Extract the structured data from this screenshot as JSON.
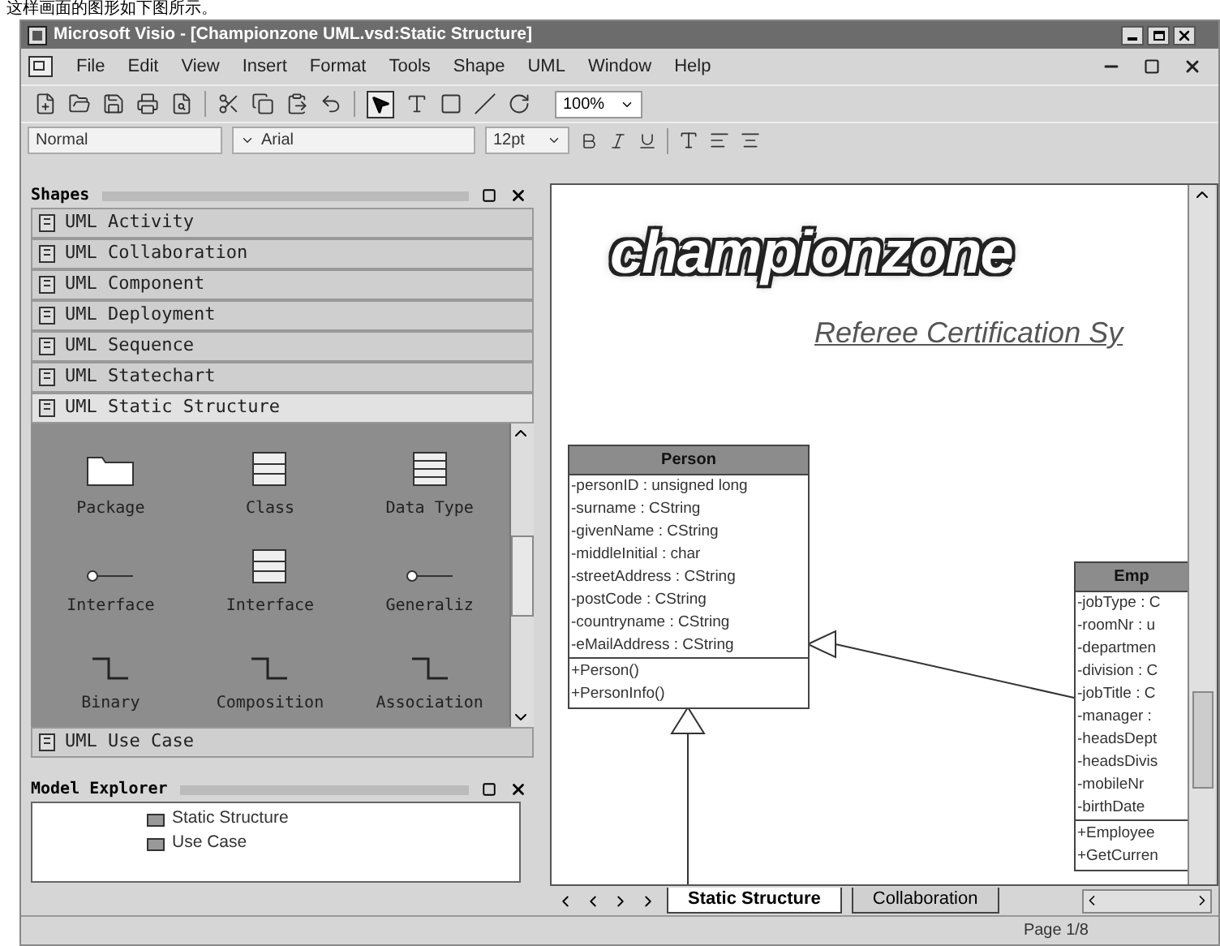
{
  "caption": "这样画面的图形如下图所示。",
  "window": {
    "title": "Microsoft Visio - [Championzone UML.vsd:Static Structure]"
  },
  "menu": [
    "File",
    "Edit",
    "View",
    "Insert",
    "Format",
    "Tools",
    "Shape",
    "UML",
    "Window",
    "Help"
  ],
  "toolbar": {
    "zoom": "100%"
  },
  "format_toolbar": {
    "style": "Normal",
    "font": "Arial",
    "size": "12pt"
  },
  "shapes_panel": {
    "title": "Shapes",
    "stencils": [
      {
        "label": "UML Activity",
        "expanded": false
      },
      {
        "label": "UML Collaboration",
        "expanded": false
      },
      {
        "label": "UML Component",
        "expanded": false
      },
      {
        "label": "UML Deployment",
        "expanded": false
      },
      {
        "label": "UML Sequence",
        "expanded": false
      },
      {
        "label": "UML Statechart",
        "expanded": false
      },
      {
        "label": "UML Static Structure",
        "expanded": true
      },
      {
        "label": "UML Use Case",
        "expanded": false
      }
    ],
    "masters": [
      {
        "label": "Package",
        "kind": "package"
      },
      {
        "label": "Class",
        "kind": "class"
      },
      {
        "label": "Data Type",
        "kind": "datatype"
      },
      {
        "label": "Interface",
        "kind": "lollipop"
      },
      {
        "label": "Interface",
        "kind": "class"
      },
      {
        "label": "Generaliz",
        "kind": "lollipop"
      },
      {
        "label": "Binary",
        "kind": "step"
      },
      {
        "label": "Composition",
        "kind": "step"
      },
      {
        "label": "Association",
        "kind": "step"
      }
    ]
  },
  "model_explorer": {
    "title": "Model Explorer",
    "items": [
      "Static Structure",
      "Use Case"
    ]
  },
  "drawing": {
    "logo": "championzone",
    "heading": "Referee Certification Sy",
    "classes": [
      {
        "name": "Person",
        "attributes": [
          "-personID : unsigned long",
          "-surname : CString",
          "-givenName : CString",
          "-middleInitial : char",
          "-streetAddress : CString",
          "-postCode : CString",
          "-countryname : CString",
          "-eMailAddress : CString"
        ],
        "operations": [
          "+Person()",
          "+PersonInfo()"
        ]
      },
      {
        "name": "Emp",
        "attributes": [
          "-jobType : C",
          "-roomNr : u",
          "-departmen",
          "-division : C",
          "-jobTitle : C",
          "-manager :",
          "-headsDept",
          "-headsDivis",
          "-mobileNr",
          "-birthDate"
        ],
        "operations": [
          "+Employee",
          "+GetCurren"
        ]
      }
    ]
  },
  "page_tabs": [
    {
      "label": "Static Structure",
      "selected": true
    },
    {
      "label": "Collaboration",
      "selected": false
    }
  ],
  "status_bar": {
    "page": "Page 1/8"
  }
}
